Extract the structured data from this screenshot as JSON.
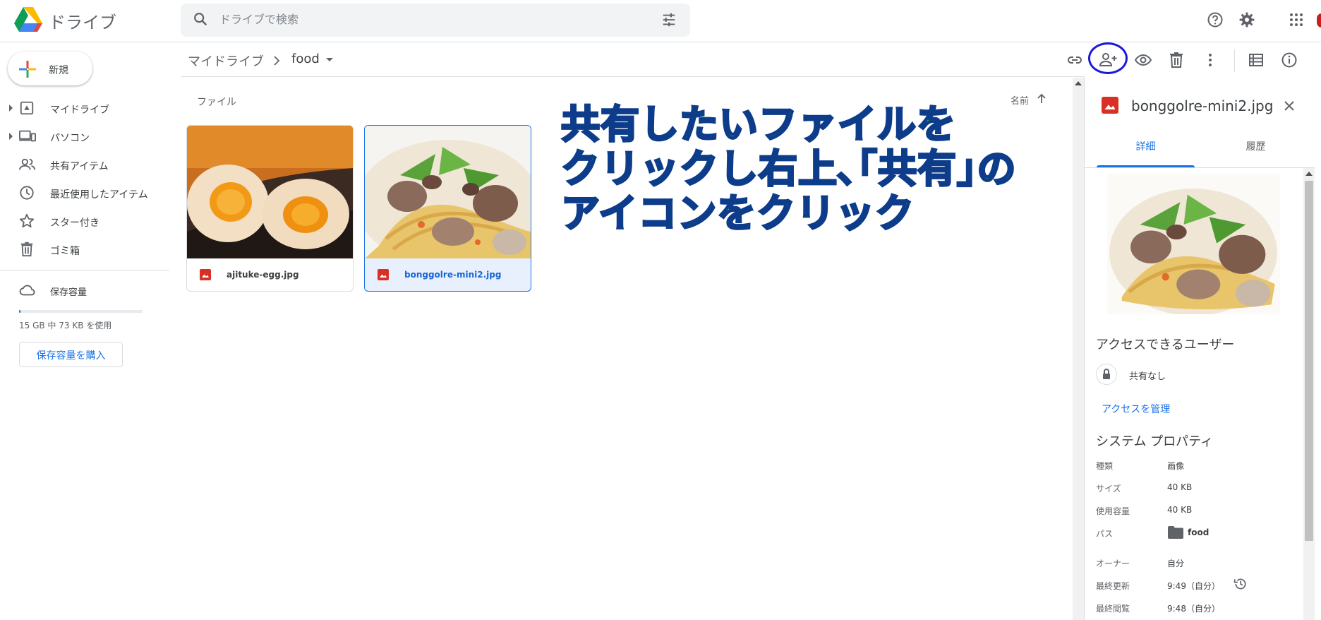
{
  "header": {
    "app_title": "ドライブ",
    "search_placeholder": "ドライブで検索"
  },
  "sidebar": {
    "new_label": "新規",
    "items": [
      {
        "label": "マイドライブ",
        "icon": "my-drive-icon"
      },
      {
        "label": "パソコン",
        "icon": "computers-icon"
      },
      {
        "label": "共有アイテム",
        "icon": "shared-icon"
      },
      {
        "label": "最近使用したアイテム",
        "icon": "clock-icon"
      },
      {
        "label": "スター付き",
        "icon": "star-icon"
      },
      {
        "label": "ゴミ箱",
        "icon": "trash-icon"
      }
    ],
    "storage_label": "保存容量",
    "storage_usage": "15 GB 中 73 KB を使用",
    "buy_storage_label": "保存容量を購入"
  },
  "toolbar": {
    "breadcrumb_root": "マイドライブ",
    "breadcrumb_current": "food"
  },
  "main": {
    "section_label": "ファイル",
    "sort_label": "名前",
    "files": [
      {
        "name": "ajituke-egg.jpg",
        "selected": false
      },
      {
        "name": "bonggolre-mini2.jpg",
        "selected": true
      }
    ],
    "annotation": [
      "共有したいファイルを",
      "クリックし右上､｢共有｣の",
      "アイコンをクリック"
    ]
  },
  "details": {
    "title": "bonggolre-mini2.jpg",
    "tab_details": "詳細",
    "tab_activity": "履歴",
    "access_heading": "アクセスできるユーザー",
    "share_status": "共有なし",
    "manage_access": "アクセスを管理",
    "props_heading": "システム プロパティ",
    "properties": [
      {
        "key": "種類",
        "value": "画像"
      },
      {
        "key": "サイズ",
        "value": "40 KB"
      },
      {
        "key": "使用容量",
        "value": "40 KB"
      },
      {
        "key": "パス",
        "value": "food"
      },
      {
        "key": "オーナー",
        "value": "自分"
      },
      {
        "key": "最終更新",
        "value": "9:49（自分）"
      },
      {
        "key": "最終閲覧",
        "value": "9:48（自分）"
      }
    ]
  },
  "colors": {
    "accent": "#1a73e8",
    "annotation_fill": "#22e22a",
    "annotation_stroke": "#0d3c8a",
    "highlight_circle": "#1a1ad8",
    "image_icon": "#d93025"
  }
}
